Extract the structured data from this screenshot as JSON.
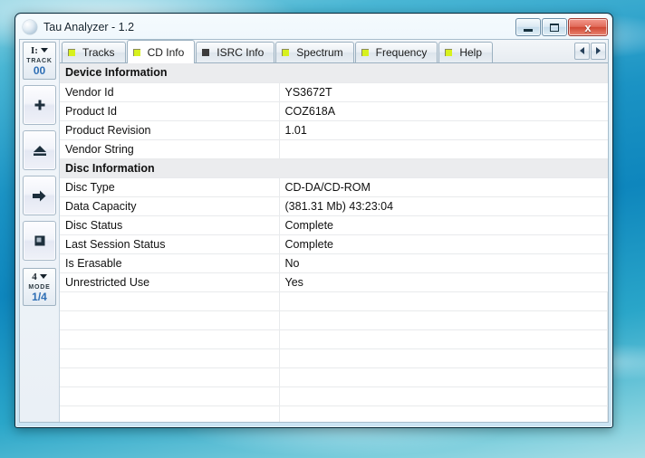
{
  "window": {
    "title": "Tau Analyzer - 1.2",
    "icon": "disc-icon",
    "buttons": {
      "minimize": "minimize",
      "maximize": "maximize",
      "close": "x"
    }
  },
  "sidebar": {
    "drive_selector": {
      "value": "I:",
      "label": "TRACK",
      "sub_value": "00"
    },
    "buttons": [
      {
        "name": "add-button",
        "icon": "plus-icon"
      },
      {
        "name": "eject-button",
        "icon": "eject-icon"
      },
      {
        "name": "play-button",
        "icon": "right-arrow-icon"
      },
      {
        "name": "stop-button",
        "icon": "stop-square-icon"
      }
    ],
    "mode_selector": {
      "value": "4",
      "label": "MODE",
      "sub_value": "1/4"
    }
  },
  "tabs": [
    {
      "label": "Tracks",
      "icon": "green-square-icon",
      "active": false
    },
    {
      "label": "CD Info",
      "icon": "green-square-icon",
      "active": true
    },
    {
      "label": "ISRC Info",
      "icon": "grey-square-icon",
      "active": false
    },
    {
      "label": "Spectrum",
      "icon": "green-square-icon",
      "active": false
    },
    {
      "label": "Frequency",
      "icon": "green-square-icon",
      "active": false
    },
    {
      "label": "Help",
      "icon": "green-square-icon",
      "active": false
    }
  ],
  "tab_scroll": {
    "left": "left-arrow-icon",
    "right": "right-arrow-icon"
  },
  "table": {
    "rows": [
      {
        "type": "section",
        "key": "Device Information",
        "value": ""
      },
      {
        "type": "data",
        "key": "Vendor Id",
        "value": "YS3672T"
      },
      {
        "type": "data",
        "key": "Product Id",
        "value": "COZ618A"
      },
      {
        "type": "data",
        "key": "Product Revision",
        "value": "1.01"
      },
      {
        "type": "data",
        "key": "Vendor String",
        "value": ""
      },
      {
        "type": "section",
        "key": "Disc Information",
        "value": ""
      },
      {
        "type": "data",
        "key": "Disc Type",
        "value": "CD-DA/CD-ROM"
      },
      {
        "type": "data",
        "key": "Data Capacity",
        "value": "(381.31 Mb) 43:23:04"
      },
      {
        "type": "data",
        "key": "Disc Status",
        "value": "Complete"
      },
      {
        "type": "data",
        "key": "Last Session Status",
        "value": "Complete"
      },
      {
        "type": "data",
        "key": "Is Erasable",
        "value": "No"
      },
      {
        "type": "data",
        "key": "Unrestricted Use",
        "value": "Yes"
      },
      {
        "type": "blank",
        "key": "",
        "value": ""
      },
      {
        "type": "blank",
        "key": "",
        "value": ""
      },
      {
        "type": "blank",
        "key": "",
        "value": ""
      },
      {
        "type": "blank",
        "key": "",
        "value": ""
      },
      {
        "type": "blank",
        "key": "",
        "value": ""
      },
      {
        "type": "blank",
        "key": "",
        "value": ""
      },
      {
        "type": "blank",
        "key": "",
        "value": ""
      },
      {
        "type": "blank",
        "key": "",
        "value": ""
      }
    ]
  },
  "colors": {
    "accent_blue": "#2f6fb5",
    "tab_icon_green": "#d7f11e",
    "section_header_bg": "#ebecee",
    "close_button_red": "#cf4632",
    "desktop_blue": "#1b93c4"
  }
}
